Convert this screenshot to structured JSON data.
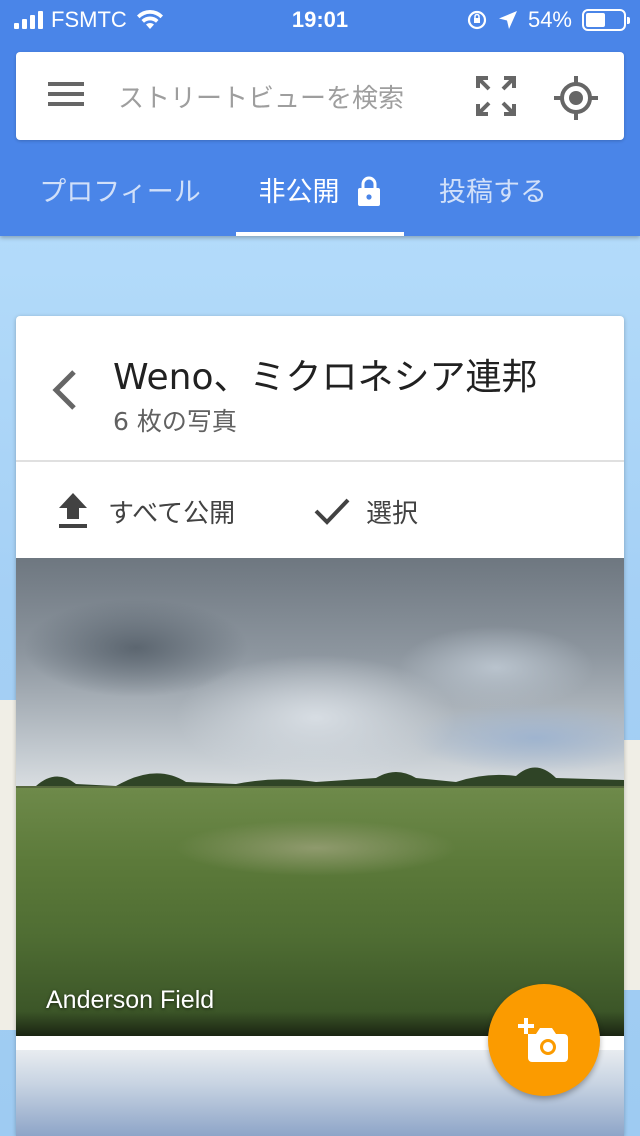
{
  "status_bar": {
    "carrier": "FSMTC",
    "time": "19:01",
    "battery_percent": "54%",
    "battery_level": 0.54,
    "icons": [
      "signal-icon",
      "wifi-icon",
      "orientation-lock-icon",
      "location-arrow-icon",
      "battery-icon"
    ]
  },
  "search": {
    "placeholder": "ストリートビューを検索",
    "icons": [
      "menu-icon",
      "fullscreen-icon",
      "my-location-icon"
    ]
  },
  "tabs": [
    {
      "label": "プロフィール",
      "active": false
    },
    {
      "label": "非公開",
      "active": true,
      "icon": "lock-icon"
    },
    {
      "label": "投稿する",
      "active": false
    }
  ],
  "card": {
    "title": "Weno、ミクロネシア連邦",
    "subtitle": "6 枚の写真",
    "actions": {
      "publish_all": "すべて公開",
      "select": "選択"
    },
    "photos": [
      {
        "label": "Anderson Field"
      }
    ]
  },
  "fab": {
    "icon": "add-photo-icon",
    "color": "#fb9b00"
  },
  "colors": {
    "header": "#4a85e8",
    "fab": "#fb9b00"
  }
}
